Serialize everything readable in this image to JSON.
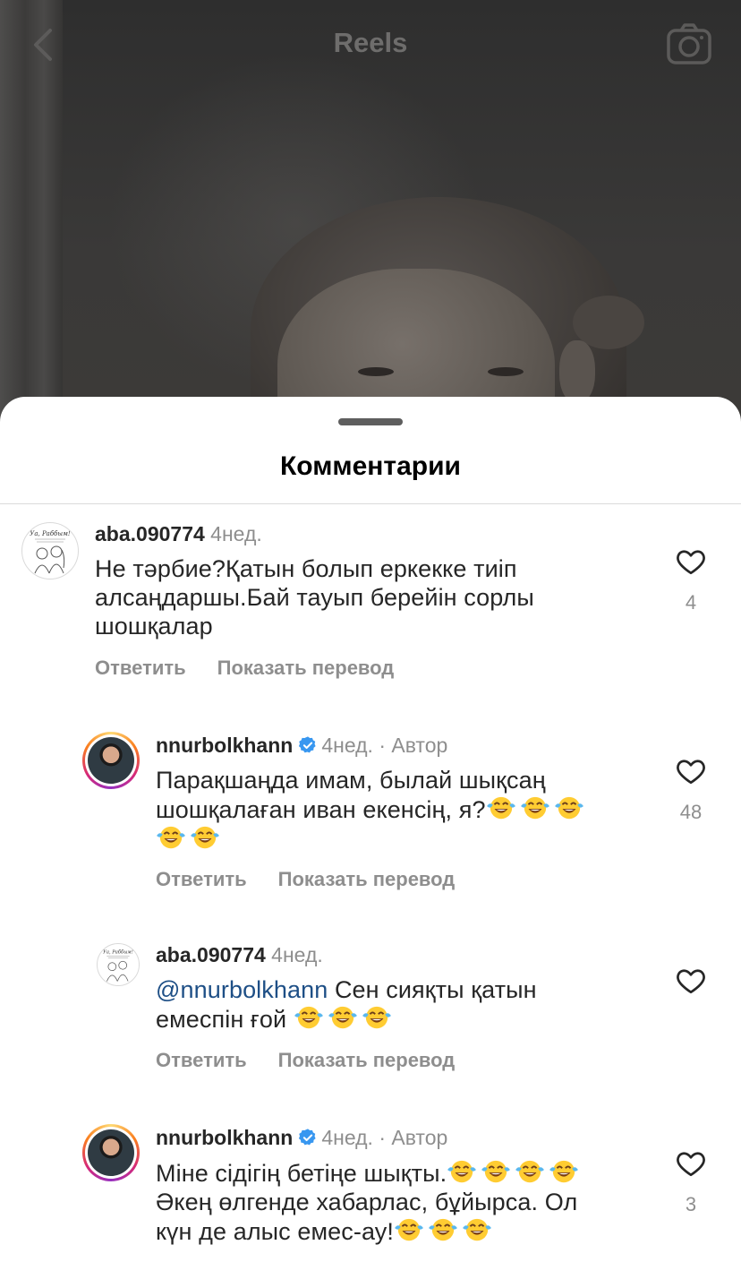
{
  "header": {
    "title": "Reels"
  },
  "sheet": {
    "title": "Комментарии"
  },
  "comments": [
    {
      "username": "aba.090774",
      "time": "4нед.",
      "text_lines": [
        "Не тәрбие?Қатын болып еркекке тиіп",
        "алсаңдаршы.Бай тауып берейін сорлы",
        "шошқалар"
      ],
      "reply_label": "Ответить",
      "translate_label": "Показать перевод",
      "likes": "4"
    },
    {
      "username": "nnurbolkhann",
      "time": "4нед.",
      "author_label": "Автор",
      "separator": "·",
      "text_line1": "Парақшаңда имам, былай шықсаң",
      "text_line2": "шошқалаған иван екенсің, я?",
      "reply_label": "Ответить",
      "translate_label": "Показать перевод",
      "likes": "48"
    },
    {
      "username": "aba.090774",
      "time": "4нед.",
      "mention": "@nnurbolkhann",
      "text_line1": " Сен сияқты қатын",
      "text_line2": "емеспін ғой ",
      "reply_label": "Ответить",
      "translate_label": "Показать перевод"
    },
    {
      "username": "nnurbolkhann",
      "time": "4нед.",
      "author_label": "Автор",
      "separator": "·",
      "text_line1": "Міне сідігің бетіңе шықты.",
      "text_line2": "Әкең өлгенде хабарлас, бұйырса. Ол",
      "text_line3": "күн де алыс емес-ау!",
      "likes": "3"
    }
  ],
  "icons": {
    "back": "chevron-left-icon",
    "camera": "camera-icon",
    "like": "heart-outline-icon",
    "verified": "verified-badge-icon",
    "emoji": "face-with-tears-of-joy-emoji"
  },
  "colors": {
    "verified": "#3897f0",
    "mention": "#1e4f86",
    "secondary_text": "#8e8e8e"
  }
}
